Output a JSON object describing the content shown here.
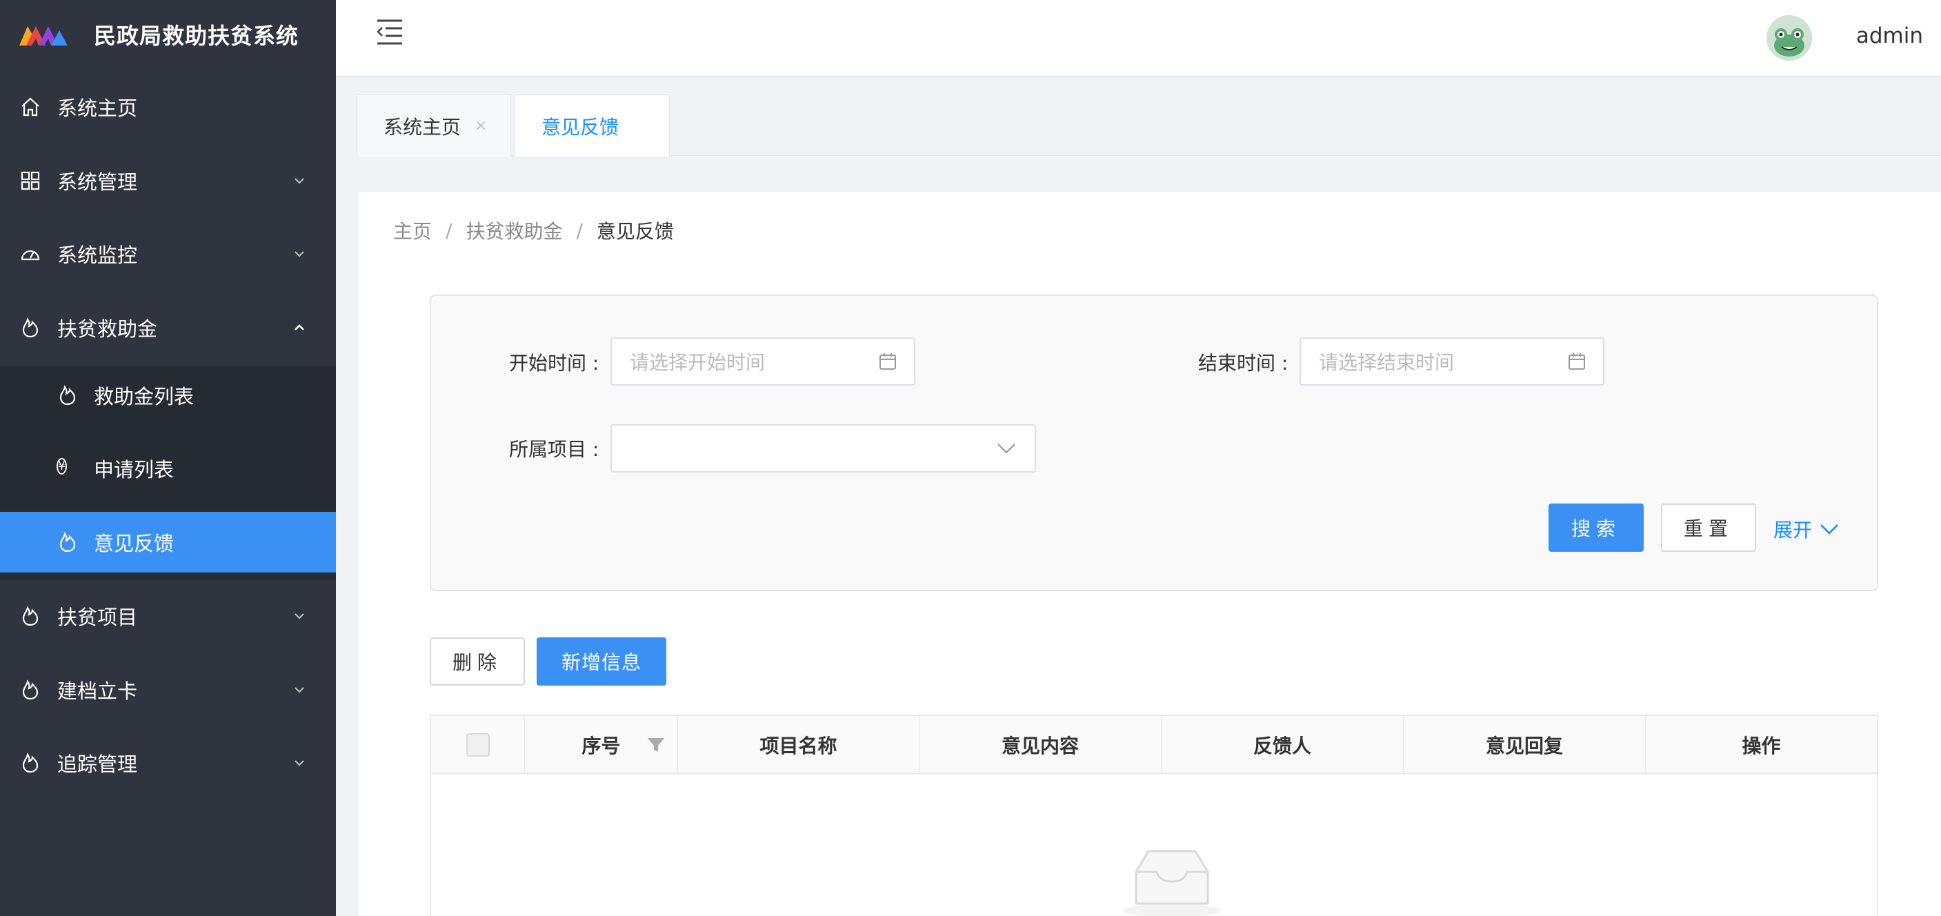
{
  "app": {
    "title": "民政局救助扶贫系统",
    "accent_color": "#3a90f3",
    "sidebar_bg": "#30343f"
  },
  "sidebar": {
    "items": [
      {
        "label": "系统主页",
        "icon": "home-icon"
      },
      {
        "label": "系统管理",
        "icon": "grid-icon",
        "expandable": true
      },
      {
        "label": "系统监控",
        "icon": "dashboard-icon",
        "expandable": true
      },
      {
        "label": "扶贫救助金",
        "icon": "flame-icon",
        "expandable": true,
        "expanded": true
      },
      {
        "label": "救助金列表",
        "icon": "flame-icon",
        "sub": true
      },
      {
        "label": "申请列表",
        "icon": "yen-icon",
        "sub": true,
        "icon_text": "¥"
      },
      {
        "label": "意见反馈",
        "icon": "flame-icon",
        "sub": true,
        "active": true
      },
      {
        "label": "扶贫项目",
        "icon": "flame-icon",
        "expandable": true
      },
      {
        "label": "建档立卡",
        "icon": "flame-icon",
        "expandable": true
      },
      {
        "label": "追踪管理",
        "icon": "flame-icon",
        "expandable": true
      }
    ]
  },
  "header": {
    "username": "admin"
  },
  "tabs": [
    {
      "label": "系统主页",
      "close": "×",
      "active": false
    },
    {
      "label": "意见反馈",
      "active": true
    }
  ],
  "breadcrumb": {
    "items": [
      "主页",
      "扶贫救助金",
      "意见反馈"
    ],
    "separator": "/"
  },
  "search": {
    "start_label": "开始时间 :",
    "start_placeholder": "请选择开始时间",
    "end_label": "结束时间 :",
    "end_placeholder": "请选择结束时间",
    "project_label": "所属项目 :",
    "project_value": "",
    "search_button": "搜索",
    "reset_button": "重置",
    "expand_link": "展开"
  },
  "toolbar": {
    "delete_button": "删除",
    "add_button": "新增信息"
  },
  "table": {
    "columns": [
      "序号",
      "项目名称",
      "意见内容",
      "反馈人",
      "意见回复",
      "操作"
    ],
    "rows": []
  }
}
